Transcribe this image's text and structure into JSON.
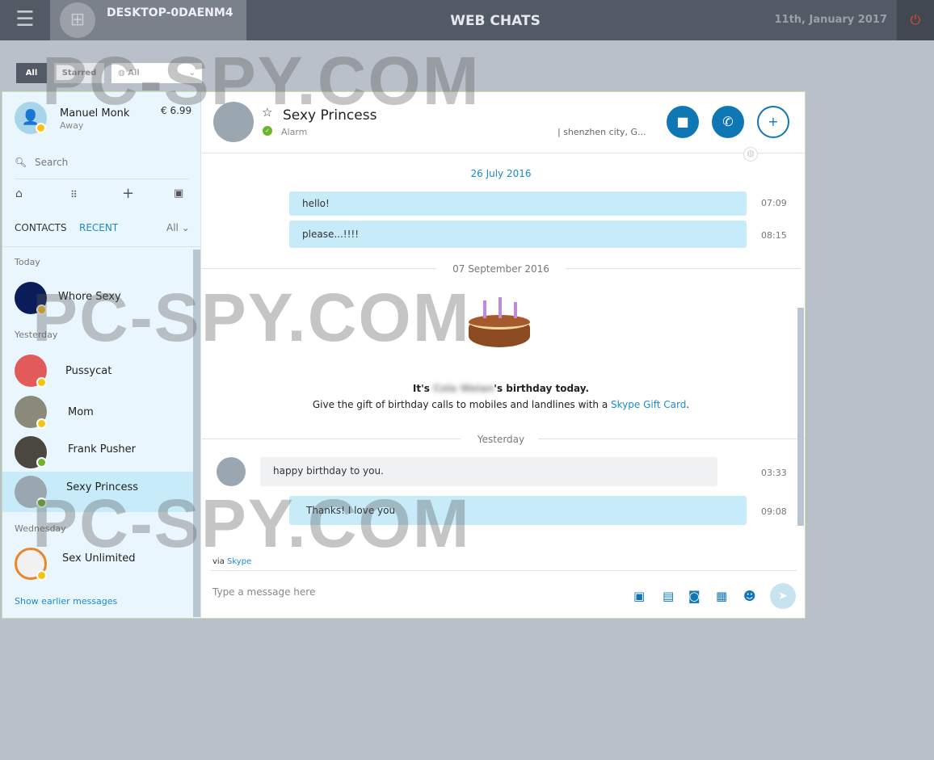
{
  "topbar": {
    "computer": "DESKTOP-0DAENM4",
    "title": "WEB CHATS",
    "date": "11th, January 2017"
  },
  "filters": {
    "all": "All",
    "starred": "Starred",
    "select": "All"
  },
  "profile": {
    "name": "Manuel Monk",
    "status": "Away",
    "credit": "€ 6.99"
  },
  "search": {
    "placeholder": "Search"
  },
  "tabs": {
    "contacts": "CONTACTS",
    "recent": "RECENT",
    "filter": "All"
  },
  "sections": {
    "today": "Today",
    "yesterday": "Yesterday",
    "wednesday": "Wednesday"
  },
  "contacts": [
    {
      "name": "Whore Sexy",
      "status": "away"
    },
    {
      "name": "Pussycat",
      "status": "away"
    },
    {
      "name": "Mom",
      "status": "away"
    },
    {
      "name": "Frank Pusher",
      "status": "online"
    },
    {
      "name": "Sexy Princess",
      "status": "online",
      "selected": true
    },
    {
      "name": "Sex Unlimited",
      "status": "away"
    }
  ],
  "show_earlier": "Show earlier messages",
  "chat": {
    "name": "Sexy Princess",
    "mood": "Alarm",
    "location": "| shenzhen city, G...",
    "date1": "26 July 2016",
    "messages1": [
      {
        "text": "hello!",
        "time": "07:09"
      },
      {
        "text": "please...!!!!",
        "time": "08:15"
      }
    ],
    "date2": "07 September 2016",
    "birthday_pre": "It's ",
    "birthday_name": "Cola Weian",
    "birthday_post": "'s birthday today.",
    "gift_text": "Give the gift of birthday calls to mobiles and landlines with a ",
    "gift_link": "Skype Gift Card",
    "gift_end": ".",
    "date3": "Yesterday",
    "incoming": {
      "text": "happy birthday to you.",
      "time": "03:33"
    },
    "outgoing": {
      "text": "Thanks! I love you",
      "time": "09:08"
    },
    "via": "via ",
    "via_link": "Skype",
    "input_placeholder": "Type a message here"
  },
  "watermark": "PC-SPY.COM",
  "colors": {
    "accent": "#0f78b4",
    "bubble": "#c7ebf9",
    "sidebar": "#eaf6fd"
  }
}
